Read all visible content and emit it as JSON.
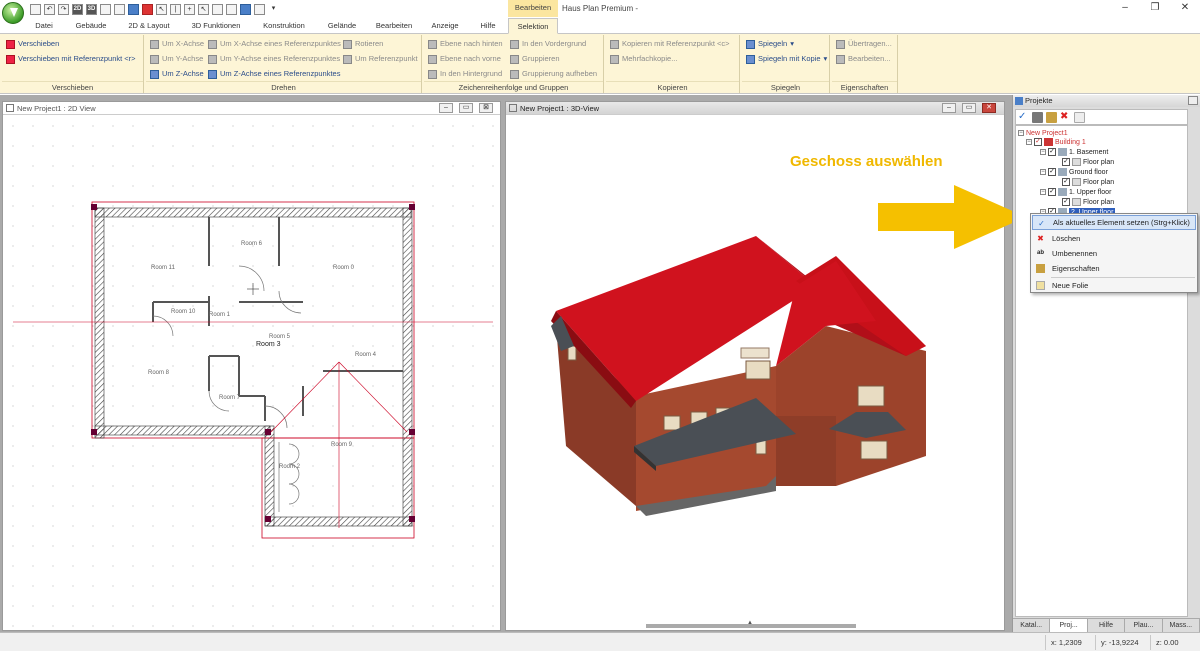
{
  "app": {
    "title": "Haus Plan Premium -",
    "contextual_group": "Bearbeiten"
  },
  "tabs": [
    "Datei",
    "Gebäude",
    "2D & Layout",
    "3D Funktionen",
    "Konstruktion",
    "Gelände",
    "Bearbeiten",
    "Anzeige",
    "Hilfe",
    "Selektion"
  ],
  "ribbon": {
    "verschieben": {
      "label": "Verschieben",
      "items": [
        "Verschieben",
        "Verschieben mit Referenzpunkt <r>"
      ]
    },
    "drehen": {
      "label": "Drehen",
      "items": [
        "Um X-Achse",
        "Um Y-Achse",
        "Um Z-Achse",
        "Um X-Achse eines Referenzpunktes",
        "Um Y-Achse eines Referenzpunktes",
        "Um Z-Achse eines Referenzpunktes",
        "Rotieren",
        "Um Referenzpunkt"
      ]
    },
    "zeichenreihenfolge": {
      "label": "Zeichenreihenfolge und Gruppen",
      "items": [
        "Ebene nach hinten",
        "Ebene nach vorne",
        "In den Hintergrund",
        "In den Vordergrund",
        "Gruppieren",
        "Gruppierung aufheben"
      ]
    },
    "kopieren": {
      "label": "Kopieren",
      "items": [
        "Kopieren mit Referenzpunkt <c>",
        "Mehrfachkopie..."
      ]
    },
    "spiegeln": {
      "label": "Spiegeln",
      "items": [
        "Spiegeln",
        "Spiegeln mit Kopie"
      ]
    },
    "eigenschaften": {
      "label": "Eigenschaften",
      "items": [
        "Übertragen...",
        "Bearbeiten..."
      ]
    }
  },
  "windows": {
    "view2d": {
      "title": "New Project1 : 2D View",
      "rooms": [
        "Room 11",
        "Room 6",
        "Room 0",
        "Room 10",
        "Room 1",
        "Room 5",
        "Room 3",
        "Room 8",
        "Room 4",
        "Room 7",
        "Room 2",
        "Room 9"
      ]
    },
    "view3d": {
      "title": "New Project1 : 3D-View"
    }
  },
  "annotation": {
    "callout": "Geschoss auswählen"
  },
  "panel": {
    "title": "Projekte",
    "tree": {
      "project": "New Project1",
      "building": "Building 1",
      "floors": [
        {
          "name": "1. Basement",
          "plan": "Floor plan"
        },
        {
          "name": "Ground floor",
          "plan": "Floor plan"
        },
        {
          "name": "1. Upper floor",
          "plan": "Floor plan"
        },
        {
          "name": "2. Upper floor",
          "plan": ""
        }
      ]
    },
    "context_menu": [
      "Als aktuelles Element setzen (Strg+Klick)",
      "Löschen",
      "Umbenennen",
      "Eigenschaften",
      "Neue Folie"
    ],
    "bottom_tabs": [
      "Katal...",
      "Proj...",
      "Hilfe",
      "Plau...",
      "Mass..."
    ]
  },
  "status": {
    "x": "x: 1,2309",
    "y": "y: -13,9224",
    "z": "z: 0.00"
  },
  "colors": {
    "roof": "#d0121e",
    "brick": "#a0482f",
    "callout": "#f0b800",
    "ribbon_bg": "#fdf5d6",
    "selection": "#2f5fbd"
  }
}
